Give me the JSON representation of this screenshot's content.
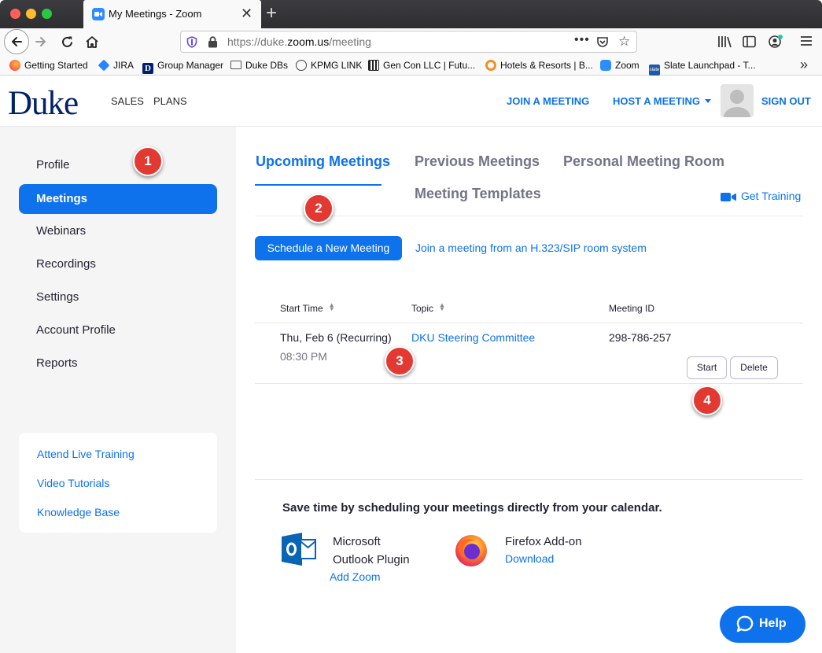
{
  "browser": {
    "tab_title": "My Meetings - Zoom",
    "url_prefix": "https://duke.",
    "url_host": "zoom.us",
    "url_path": "/meeting",
    "bookmarks": [
      {
        "label": "Getting Started",
        "icon": "firefox-icon"
      },
      {
        "label": "JIRA",
        "icon": "jira-icon"
      },
      {
        "label": "Group Manager",
        "icon": "duke-d-icon"
      },
      {
        "label": "Duke DBs",
        "icon": "folder-icon"
      },
      {
        "label": "KPMG LINK",
        "icon": "globe-icon"
      },
      {
        "label": "Gen Con LLC | Futu...",
        "icon": "gencon-icon"
      },
      {
        "label": "Hotels & Resorts | B...",
        "icon": "ring-icon"
      },
      {
        "label": "Zoom",
        "icon": "zoom-icon"
      },
      {
        "label": "Slate Launchpad - T...",
        "icon": "slate-icon"
      }
    ]
  },
  "header": {
    "logo": "Duke",
    "nav": {
      "sales": "SALES",
      "plans": "PLANS"
    },
    "join": "JOIN A MEETING",
    "host": "HOST A MEETING",
    "signout": "SIGN OUT"
  },
  "sidebar": {
    "items": [
      {
        "label": "Profile"
      },
      {
        "label": "Meetings",
        "active": true
      },
      {
        "label": "Webinars"
      },
      {
        "label": "Recordings"
      },
      {
        "label": "Settings"
      },
      {
        "label": "Account Profile"
      },
      {
        "label": "Reports"
      }
    ],
    "help_links": [
      "Attend Live Training",
      "Video Tutorials",
      "Knowledge Base"
    ]
  },
  "main": {
    "tabs": [
      "Upcoming Meetings",
      "Previous Meetings",
      "Personal Meeting Room",
      "Meeting Templates"
    ],
    "get_training": "Get Training",
    "schedule_button": "Schedule a New Meeting",
    "sip_link": "Join a meeting from an H.323/SIP room system",
    "table": {
      "headers": {
        "start_time": "Start Time",
        "topic": "Topic",
        "meeting_id": "Meeting ID"
      },
      "rows": [
        {
          "date": "Thu, Feb 6 (Recurring)",
          "time": "08:30 PM",
          "topic": "DKU Steering Committee",
          "meeting_id": "298-786-257",
          "start": "Start",
          "delete": "Delete"
        }
      ]
    },
    "calendar": {
      "title": "Save time by scheduling your meetings directly from your calendar.",
      "outlook": {
        "line1": "Microsoft",
        "line2": "Outlook Plugin",
        "link": "Add Zoom"
      },
      "firefox": {
        "name": "Firefox Add-on",
        "link": "Download"
      }
    },
    "help_button": "Help"
  },
  "callouts": [
    "1",
    "2",
    "3",
    "4"
  ],
  "colors": {
    "accent": "#0e72ed",
    "duke_navy": "#012169",
    "callout": "#e23a33"
  }
}
